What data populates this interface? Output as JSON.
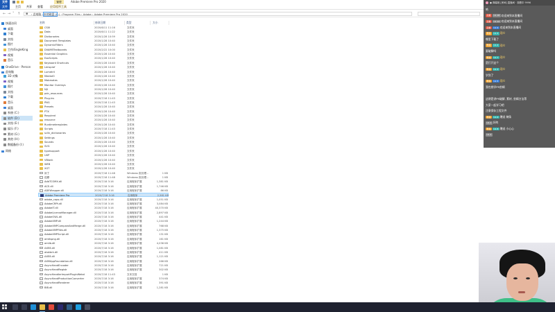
{
  "window": {
    "title": "Adobe Premiere Pro 2020",
    "app_badge": "文件",
    "manage_tab": "管理"
  },
  "ribbon": {
    "tabs": [
      "文件",
      "主页",
      "共享",
      "查看",
      "应用程序工具"
    ]
  },
  "address": {
    "path": "› 此电脑 › 本地磁盘 (C:) › Program Files › Adobe › Adobe Premiere Pro 2020"
  },
  "nav": {
    "items": [
      {
        "label": "快速访问",
        "kind": "root",
        "color": "#2f7fd1"
      },
      {
        "label": "桌面",
        "color": "#3b82d8"
      },
      {
        "label": "下载",
        "color": "#2f7fd1"
      },
      {
        "label": "文档",
        "color": "#7e8a9a"
      },
      {
        "label": "图片",
        "color": "#3f91d9"
      },
      {
        "label": "工作/EngleKing",
        "color": "#e8bf4a"
      },
      {
        "label": "视频",
        "color": "#7e63c8"
      },
      {
        "label": "音乐",
        "color": "#e07b39"
      },
      {
        "label": "OneDrive - Person",
        "kind": "root",
        "color": "#1f78d1"
      },
      {
        "label": "此电脑",
        "kind": "root",
        "color": "#3b82d8"
      },
      {
        "label": "3D 对象",
        "color": "#3fa1d9"
      },
      {
        "label": "视频",
        "color": "#7e63c8"
      },
      {
        "label": "图片",
        "color": "#3f91d9"
      },
      {
        "label": "文档",
        "color": "#7e8a9a"
      },
      {
        "label": "下载",
        "color": "#2f7fd1"
      },
      {
        "label": "音乐",
        "color": "#e07b39"
      },
      {
        "label": "桌面",
        "color": "#3b82d8"
      },
      {
        "label": "系统 (C:)",
        "color": "#8a8a8a"
      },
      {
        "label": "软件 (D:)",
        "color": "#8a8a8a",
        "selected": true
      },
      {
        "label": "文档 (E:)",
        "color": "#8a8a8a"
      },
      {
        "label": "娱乐 (F:)",
        "color": "#8a8a8a"
      },
      {
        "label": "素材 (G:)",
        "color": "#8a8a8a"
      },
      {
        "label": "其他 (H:)",
        "color": "#8a8a8a"
      },
      {
        "label": "数据备份 (I:)",
        "color": "#8a8a8a"
      },
      {
        "label": "网络",
        "kind": "root",
        "color": "#3b82d8"
      }
    ]
  },
  "columns": {
    "name": "名称",
    "date": "修改日期",
    "type": "类型",
    "size": "大小"
  },
  "files": [
    {
      "icon": "folder",
      "name": "CSXI",
      "date": "2020/6/11 11:16",
      "type": "文件夹",
      "size": ""
    },
    {
      "icon": "folder",
      "name": "Data",
      "date": "2020/6/11 11:22",
      "type": "文件夹",
      "size": ""
    },
    {
      "icon": "folder",
      "name": "Dictionaries",
      "date": "2020/1/28 10:59",
      "type": "文件夹",
      "size": ""
    },
    {
      "icon": "folder",
      "name": "Document Templates",
      "date": "2020/1/28 10:40",
      "type": "文件夹",
      "size": ""
    },
    {
      "icon": "folder",
      "name": "DynamicFilters",
      "date": "2020/1/28 10:40",
      "type": "文件夹",
      "size": ""
    },
    {
      "icon": "folder",
      "name": "DVAMETextboards",
      "date": "2020/2/22 10:00",
      "type": "文件夹",
      "size": ""
    },
    {
      "icon": "folder",
      "name": "Essential Graphics",
      "date": "2020/1/28 10:40",
      "type": "文件夹",
      "size": ""
    },
    {
      "icon": "folder",
      "name": "ExoScripts",
      "date": "2020/1/28 10:40",
      "type": "文件夹",
      "size": ""
    },
    {
      "icon": "folder",
      "name": "Keyboard Shortcuts",
      "date": "2020/1/28 10:40",
      "type": "文件夹",
      "size": ""
    },
    {
      "icon": "folder",
      "name": "Lensprof",
      "date": "2020/1/28 10:40",
      "type": "文件夹",
      "size": ""
    },
    {
      "icon": "folder",
      "name": "LumetriI",
      "date": "2020/1/28 10:40",
      "type": "文件夹",
      "size": ""
    },
    {
      "icon": "folder",
      "name": "MediaIO",
      "date": "2020/1/28 10:40",
      "type": "文件夹",
      "size": ""
    },
    {
      "icon": "folder",
      "name": "Mobmates",
      "date": "2020/1/28 10:40",
      "type": "文件夹",
      "size": ""
    },
    {
      "icon": "folder",
      "name": "Monitor Overlays",
      "date": "2020/1/28 10:40",
      "type": "文件夹",
      "size": ""
    },
    {
      "icon": "folder",
      "name": "NJI",
      "date": "2020/1/28 10:40",
      "type": "文件夹",
      "size": ""
    },
    {
      "icon": "folder",
      "name": "pdn_resources",
      "date": "2020/1/28 10:40",
      "type": "文件夹",
      "size": ""
    },
    {
      "icon": "folder",
      "name": "Plug-ins",
      "date": "2020/7/18 11:43",
      "type": "文件夹",
      "size": ""
    },
    {
      "icon": "folder",
      "name": "PNG",
      "date": "2020/7/18 11:43",
      "type": "文件夹",
      "size": ""
    },
    {
      "icon": "folder",
      "name": "Presets",
      "date": "2020/1/28 10:40",
      "type": "文件夹",
      "size": ""
    },
    {
      "icon": "folder",
      "name": "PTX",
      "date": "2020/1/28 10:40",
      "type": "文件夹",
      "size": ""
    },
    {
      "icon": "folder",
      "name": "Required",
      "date": "2020/1/28 10:40",
      "type": "文件夹",
      "size": ""
    },
    {
      "icon": "folder",
      "name": "resource",
      "date": "2020/1/28 10:40",
      "type": "文件夹",
      "size": ""
    },
    {
      "icon": "folder",
      "name": "Runtimetemplates",
      "date": "2020/1/28 10:40",
      "type": "文件夹",
      "size": ""
    },
    {
      "icon": "folder",
      "name": "Scripts",
      "date": "2020/7/18 11:43",
      "type": "文件夹",
      "size": ""
    },
    {
      "icon": "folder",
      "name": "sclln_dictionaries",
      "date": "2020/1/28 10:40",
      "type": "文件夹",
      "size": ""
    },
    {
      "icon": "folder",
      "name": "Settings",
      "date": "2020/1/28 10:40",
      "type": "文件夹",
      "size": ""
    },
    {
      "icon": "folder",
      "name": "Sounds",
      "date": "2020/1/28 10:40",
      "type": "文件夹",
      "size": ""
    },
    {
      "icon": "folder",
      "name": "SVG",
      "date": "2020/1/28 10:40",
      "type": "文件夹",
      "size": ""
    },
    {
      "icon": "folder",
      "name": "typesupport",
      "date": "2020/1/28 10:40",
      "type": "文件夹",
      "size": ""
    },
    {
      "icon": "folder",
      "name": "UXP",
      "date": "2020/1/28 10:40",
      "type": "文件夹",
      "size": ""
    },
    {
      "icon": "folder",
      "name": "VBlank",
      "date": "2020/1/28 10:40",
      "type": "文件夹",
      "size": ""
    },
    {
      "icon": "folder",
      "name": "WEB",
      "date": "2020/1/28 10:40",
      "type": "文件夹",
      "size": ""
    },
    {
      "icon": "folder",
      "name": "XGT",
      "date": "2020/1/28 10:40",
      "type": "文件夹",
      "size": ""
    },
    {
      "icon": "file",
      "name": "补丁",
      "date": "2020/7/18 11:48",
      "type": "Windows 批处理...",
      "size": "1 KB"
    },
    {
      "icon": "file",
      "name": "还原",
      "date": "2020/7/18 11:48",
      "type": "Windows 批处理...",
      "size": "1 KB"
    },
    {
      "icon": "file",
      "name": "AdbTCOMX.dll",
      "date": "2020/7/18 3:16",
      "type": "应用程序扩展",
      "size": "1,381 KB"
    },
    {
      "icon": "file",
      "name": "ACE.dll",
      "date": "2020/7/18 3:16",
      "type": "应用程序扩展",
      "size": "1,746 KB"
    },
    {
      "icon": "file",
      "name": "ADEWrapper.dll",
      "date": "2020/7/18 3:16",
      "type": "应用程序扩展",
      "size": "86 KB"
    },
    {
      "icon": "exe",
      "name": "Adobe Premiere Pro",
      "date": "2020/7/18 3:16",
      "type": "应用程序",
      "size": "2,581 KB",
      "selected": true
    },
    {
      "icon": "file",
      "name": "adobe_caps.dll",
      "date": "2020/7/18 3:16",
      "type": "应用程序扩展",
      "size": "1,051 KB"
    },
    {
      "icon": "file",
      "name": "AdobeCRPt.dll",
      "date": "2020/7/18 3:16",
      "type": "应用程序扩展",
      "size": "3,084 KB"
    },
    {
      "icon": "file",
      "name": "AdobeIT.dll",
      "date": "2020/7/18 3:16",
      "type": "应用程序扩展",
      "size": "40,370 KB"
    },
    {
      "icon": "file",
      "name": "AdobeLicenseManager.dll",
      "date": "2020/7/18 3:16",
      "type": "应用程序扩展",
      "size": "2,897 KB"
    },
    {
      "icon": "file",
      "name": "AdobeOWL.dll",
      "date": "2020/7/18 3:16",
      "type": "应用程序扩展",
      "size": "441 KB"
    },
    {
      "icon": "file",
      "name": "AdobeXMP.dll",
      "date": "2020/7/18 3:16",
      "type": "应用程序扩展",
      "size": "1,244 KB"
    },
    {
      "icon": "file",
      "name": "AdobeXMPCompareAndMerge.dll",
      "date": "2020/7/18 3:16",
      "type": "应用程序扩展",
      "size": "768 KB"
    },
    {
      "icon": "file",
      "name": "AdobeXMPFiles.dll",
      "date": "2020/7/18 3:16",
      "type": "应用程序扩展",
      "size": "1,375 KB"
    },
    {
      "icon": "file",
      "name": "AdobeXMPScript.dll",
      "date": "2020/7/18 3:16",
      "type": "应用程序扩展",
      "size": "131 KB"
    },
    {
      "icon": "file",
      "name": "amtlspng.dll",
      "date": "2020/7/18 3:16",
      "type": "应用程序扩展",
      "size": "161 KB"
    },
    {
      "icon": "file",
      "name": "amlib.dll",
      "date": "2020/7/18 3:16",
      "type": "应用程序扩展",
      "size": "4,036 KB"
    },
    {
      "icon": "file",
      "name": "AXE8.dll",
      "date": "2020/7/18 3:16",
      "type": "应用程序扩展",
      "size": "1,081 KB"
    },
    {
      "icon": "file",
      "name": "atokbrk.dll",
      "date": "2020/7/18 3:16",
      "type": "应用程序扩展",
      "size": "411 KB"
    },
    {
      "icon": "file",
      "name": "AXE8.dll",
      "date": "2020/7/18 3:16",
      "type": "应用程序扩展",
      "size": "1,121 KB"
    },
    {
      "icon": "file",
      "name": "AXMAppFoundation.dll",
      "date": "2020/7/18 3:16",
      "type": "应用程序扩展",
      "size": "266 KB"
    },
    {
      "icon": "file",
      "name": "AsyncHandEncoder",
      "date": "2020/7/18 3:16",
      "type": "应用程序扩展",
      "size": "721 KB"
    },
    {
      "icon": "file",
      "name": "AsyncHandRegistr",
      "date": "2020/7/18 3:16",
      "type": "应用程序扩展",
      "size": "302 KB"
    },
    {
      "icon": "file",
      "name": "AsyncHandlerImportPluginWebd",
      "date": "2020/7/18 11:43",
      "type": "文本文档",
      "size": "1 KB"
    },
    {
      "icon": "file",
      "name": "AsyncHandProductionConverter",
      "date": "2020/7/18 3:16",
      "type": "应用程序扩展",
      "size": "374 KB"
    },
    {
      "icon": "file",
      "name": "AsyncHandRenderer",
      "date": "2020/7/18 3:16",
      "type": "应用程序扩展",
      "size": "391 KB"
    },
    {
      "icon": "file",
      "name": "BIB.dll",
      "date": "2020/7/18 3:16",
      "type": "应用程序扩展",
      "size": "1,281 KB"
    }
  ],
  "chat": {
    "header": "● 弹幕姬 [房间] 直播间 · 观看中 9996",
    "lines": [
      {
        "badges": [],
        "name": "",
        "msg": "哈"
      },
      {
        "badges": [
          {
            "t": "勋章",
            "c": "red"
          },
          {
            "t": "UL 18",
            "c": "gray"
          }
        ],
        "name": "",
        "msg": "欢迎来到本直播间"
      },
      {
        "badges": [
          {
            "t": "勋章",
            "c": "red"
          },
          {
            "t": "UL 12",
            "c": "gray"
          }
        ],
        "name": "",
        "msg": "欢迎来到本直播间"
      },
      {
        "badges": [
          {
            "t": "勋章",
            "c": "red"
          },
          {
            "t": "UL 9",
            "c": "blue"
          }
        ],
        "name": "",
        "msg": "欢迎来到本直播间"
      },
      {
        "badges": [
          {
            "t": "粉丝",
            "c": "orange"
          },
          {
            "t": "UL 4",
            "c": "teal"
          }
        ],
        "name": "观众",
        "msg": ""
      },
      {
        "badges": [],
        "name": "",
        "msg": "哪里下载了"
      },
      {
        "badges": [
          {
            "t": "粉丝",
            "c": "orange"
          },
          {
            "t": "UL 2",
            "c": "teal"
          }
        ],
        "name": "观众",
        "msg": ""
      },
      {
        "badges": [],
        "name": "",
        "msg": "要破解吗"
      },
      {
        "badges": [
          {
            "t": "粉丝",
            "c": "orange"
          },
          {
            "t": "UL 7",
            "c": "teal"
          }
        ],
        "name": "观众",
        "msg": ""
      },
      {
        "badges": [],
        "name": "",
        "msg": "是打开这个"
      },
      {
        "badges": [
          {
            "t": "粉丝",
            "c": "orange"
          },
          {
            "t": "UL 3",
            "c": "teal"
          }
        ],
        "name": "观众",
        "msg": ""
      },
      {
        "badges": [],
        "name": "",
        "msg": "学到了"
      },
      {
        "badges": [
          {
            "t": "粉丝",
            "c": "orange"
          },
          {
            "t": "UL 5",
            "c": "blue"
          }
        ],
        "name": "观众",
        "msg": ""
      },
      {
        "badges": [],
        "name": "",
        "msg": "我也想学PR剪辑"
      },
      {
        "badges": [],
        "name": "",
        "msg": ""
      },
      {
        "badges": [],
        "name": "",
        "msg": "这期是讲PR破解, 素材, 剪辑方法等"
      },
      {
        "badges": [],
        "name": "",
        "msg": "大家一起学习吧"
      },
      {
        "badges": [],
        "name": "",
        "msg": "注意保存工程文件"
      },
      {
        "badges": [
          {
            "t": "粉丝",
            "c": "orange"
          },
          {
            "t": "UL 6",
            "c": "teal"
          }
        ],
        "name": "",
        "msg": "赠送 辣条"
      },
      {
        "badges": [
          {
            "t": "UL 1",
            "c": "gray"
          }
        ],
        "name": "",
        "msg": "好的"
      },
      {
        "badges": [
          {
            "t": "粉丝",
            "c": "orange"
          },
          {
            "t": "UL 8",
            "c": "teal"
          }
        ],
        "name": "",
        "msg": "赠送 小心心"
      },
      {
        "badges": [
          {
            "t": "UL 2",
            "c": "gray"
          }
        ],
        "name": "",
        "msg": ""
      }
    ]
  },
  "taskbar": {
    "icons": [
      {
        "name": "search-icon",
        "color": "#3a3f52"
      },
      {
        "name": "task-view-icon",
        "color": "#3a3f52"
      },
      {
        "name": "edge-icon",
        "color": "#1f8fd6"
      },
      {
        "name": "file-explorer-icon",
        "color": "#e8bf4a"
      },
      {
        "name": "chrome-icon",
        "color": "#e24b3c"
      },
      {
        "name": "premiere-icon",
        "color": "#2b2a6e"
      },
      {
        "name": "steam-icon",
        "color": "#2f5d86"
      },
      {
        "name": "qq-icon",
        "color": "#1c9ee0"
      },
      {
        "name": "obs-icon",
        "color": "#4a4f60"
      }
    ]
  }
}
